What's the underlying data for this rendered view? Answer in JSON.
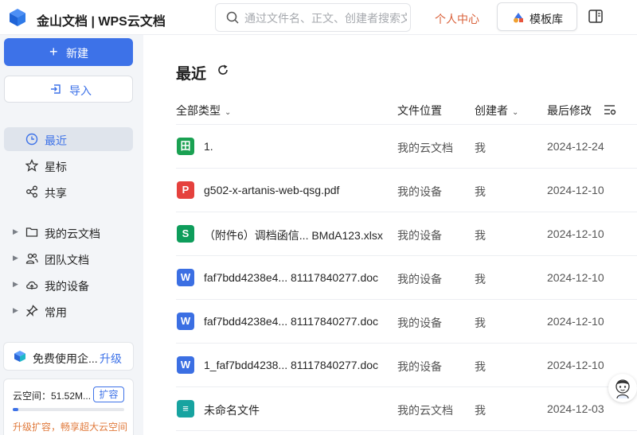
{
  "app": {
    "title": "金山文档 | WPS云文档"
  },
  "header": {
    "search_placeholder": "通过文件名、正文、创建者搜索文件",
    "personal_center": "个人中心",
    "template_label": "模板库"
  },
  "sidebar": {
    "new_label": "新建",
    "import_label": "导入",
    "nav": [
      {
        "label": "最近",
        "active": true
      },
      {
        "label": "星标"
      },
      {
        "label": "共享"
      },
      {
        "label": "我的云文档"
      },
      {
        "label": "团队文档"
      },
      {
        "label": "我的设备"
      },
      {
        "label": "常用"
      }
    ],
    "promo": {
      "text": "免费使用企...",
      "upgrade": "升级"
    },
    "storage": {
      "text": "云空间：51.52M...",
      "expand": "扩容",
      "tip": "升级扩容，畅享超大云空间",
      "progress": 0.05
    }
  },
  "main": {
    "title": "最近",
    "columns": {
      "type": "全部类型",
      "location": "文件位置",
      "creator": "创建者",
      "modified": "最后修改"
    },
    "files": [
      {
        "name": "1.",
        "type": "sheet",
        "location": "我的云文档",
        "creator": "我",
        "date": "2024-12-24"
      },
      {
        "name": "g502-x-artanis-web-qsg.pdf",
        "type": "pdf",
        "location": "我的设备",
        "creator": "我",
        "date": "2024-12-10"
      },
      {
        "name": "（附件6）调档函信... BMdA123.xlsx",
        "type": "xlsx",
        "location": "我的设备",
        "creator": "我",
        "date": "2024-12-10"
      },
      {
        "name": "faf7bdd4238e4... 81117840277.doc",
        "type": "doc",
        "location": "我的设备",
        "creator": "我",
        "date": "2024-12-10"
      },
      {
        "name": "faf7bdd4238e4... 81117840277.doc",
        "type": "doc",
        "location": "我的设备",
        "creator": "我",
        "date": "2024-12-10"
      },
      {
        "name": "1_faf7bdd4238... 81117840277.doc",
        "type": "doc",
        "location": "我的设备",
        "creator": "我",
        "date": "2024-12-10"
      },
      {
        "name": "未命名文件",
        "type": "board",
        "location": "我的云文档",
        "creator": "我",
        "date": "2024-12-03"
      }
    ]
  },
  "colors": {
    "accent": "#3d72e8",
    "personal": "#d9613a",
    "sheet": "#1aa152",
    "pdf": "#e5413d",
    "xlsx": "#0e9d5b",
    "doc": "#3b6fe3",
    "board": "#17a3a0"
  },
  "icons": {
    "sheet": "田",
    "pdf": "P",
    "xlsx": "S",
    "doc": "W",
    "board": "≡"
  }
}
